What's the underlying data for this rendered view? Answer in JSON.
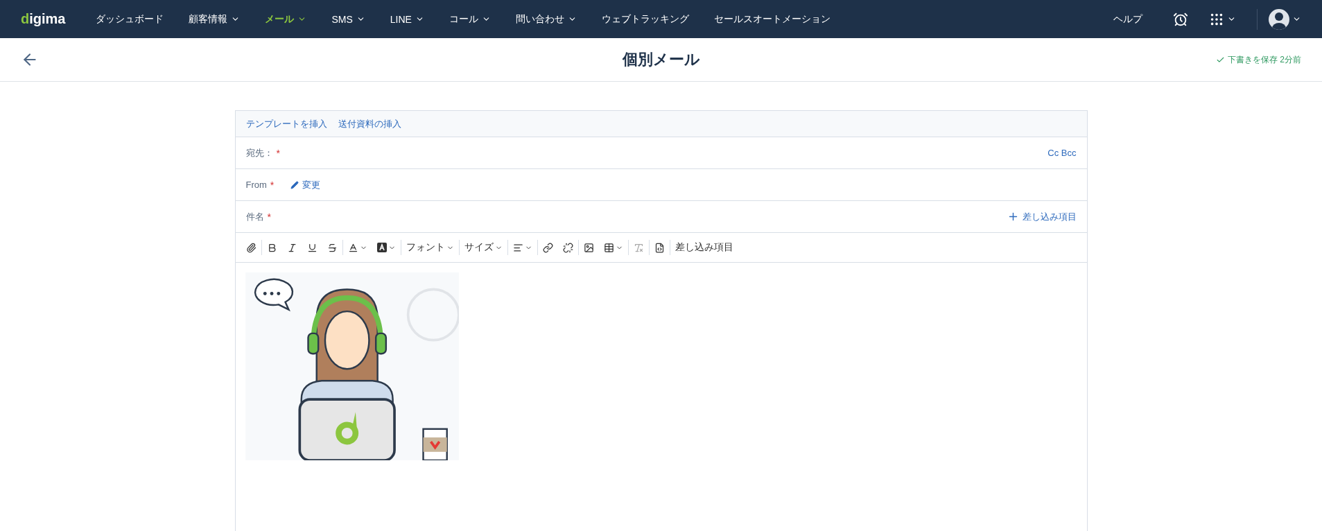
{
  "nav": {
    "logo": "digima",
    "items": [
      {
        "label": "ダッシュボード",
        "selected": false,
        "dropdown": false
      },
      {
        "label": "顧客情報",
        "selected": false,
        "dropdown": true
      },
      {
        "label": "メール",
        "selected": true,
        "dropdown": true
      },
      {
        "label": "SMS",
        "selected": false,
        "dropdown": true
      },
      {
        "label": "LINE",
        "selected": false,
        "dropdown": true
      },
      {
        "label": "コール",
        "selected": false,
        "dropdown": true
      },
      {
        "label": "問い合わせ",
        "selected": false,
        "dropdown": true
      },
      {
        "label": "ウェブトラッキング",
        "selected": false,
        "dropdown": false
      },
      {
        "label": "セールスオートメーション",
        "selected": false,
        "dropdown": false
      }
    ],
    "help": "ヘルプ"
  },
  "header": {
    "title": "個別メール",
    "save_status": "下書きを保存 2分前"
  },
  "form": {
    "links": [
      "テンプレートを挿入",
      "送付資料の挿入"
    ],
    "fields": [
      {
        "kind": "to",
        "label": "宛先：",
        "mark": "*",
        "action": "Cc Bcc"
      },
      {
        "kind": "from",
        "label": "From",
        "mark": "*",
        "action": "変更"
      },
      {
        "kind": "subject",
        "label": "件名",
        "mark": "*",
        "action": "差し込み項目"
      }
    ],
    "toolbar": {
      "font": "フォント",
      "size": "サイズ",
      "merge": "差し込み項目"
    }
  }
}
